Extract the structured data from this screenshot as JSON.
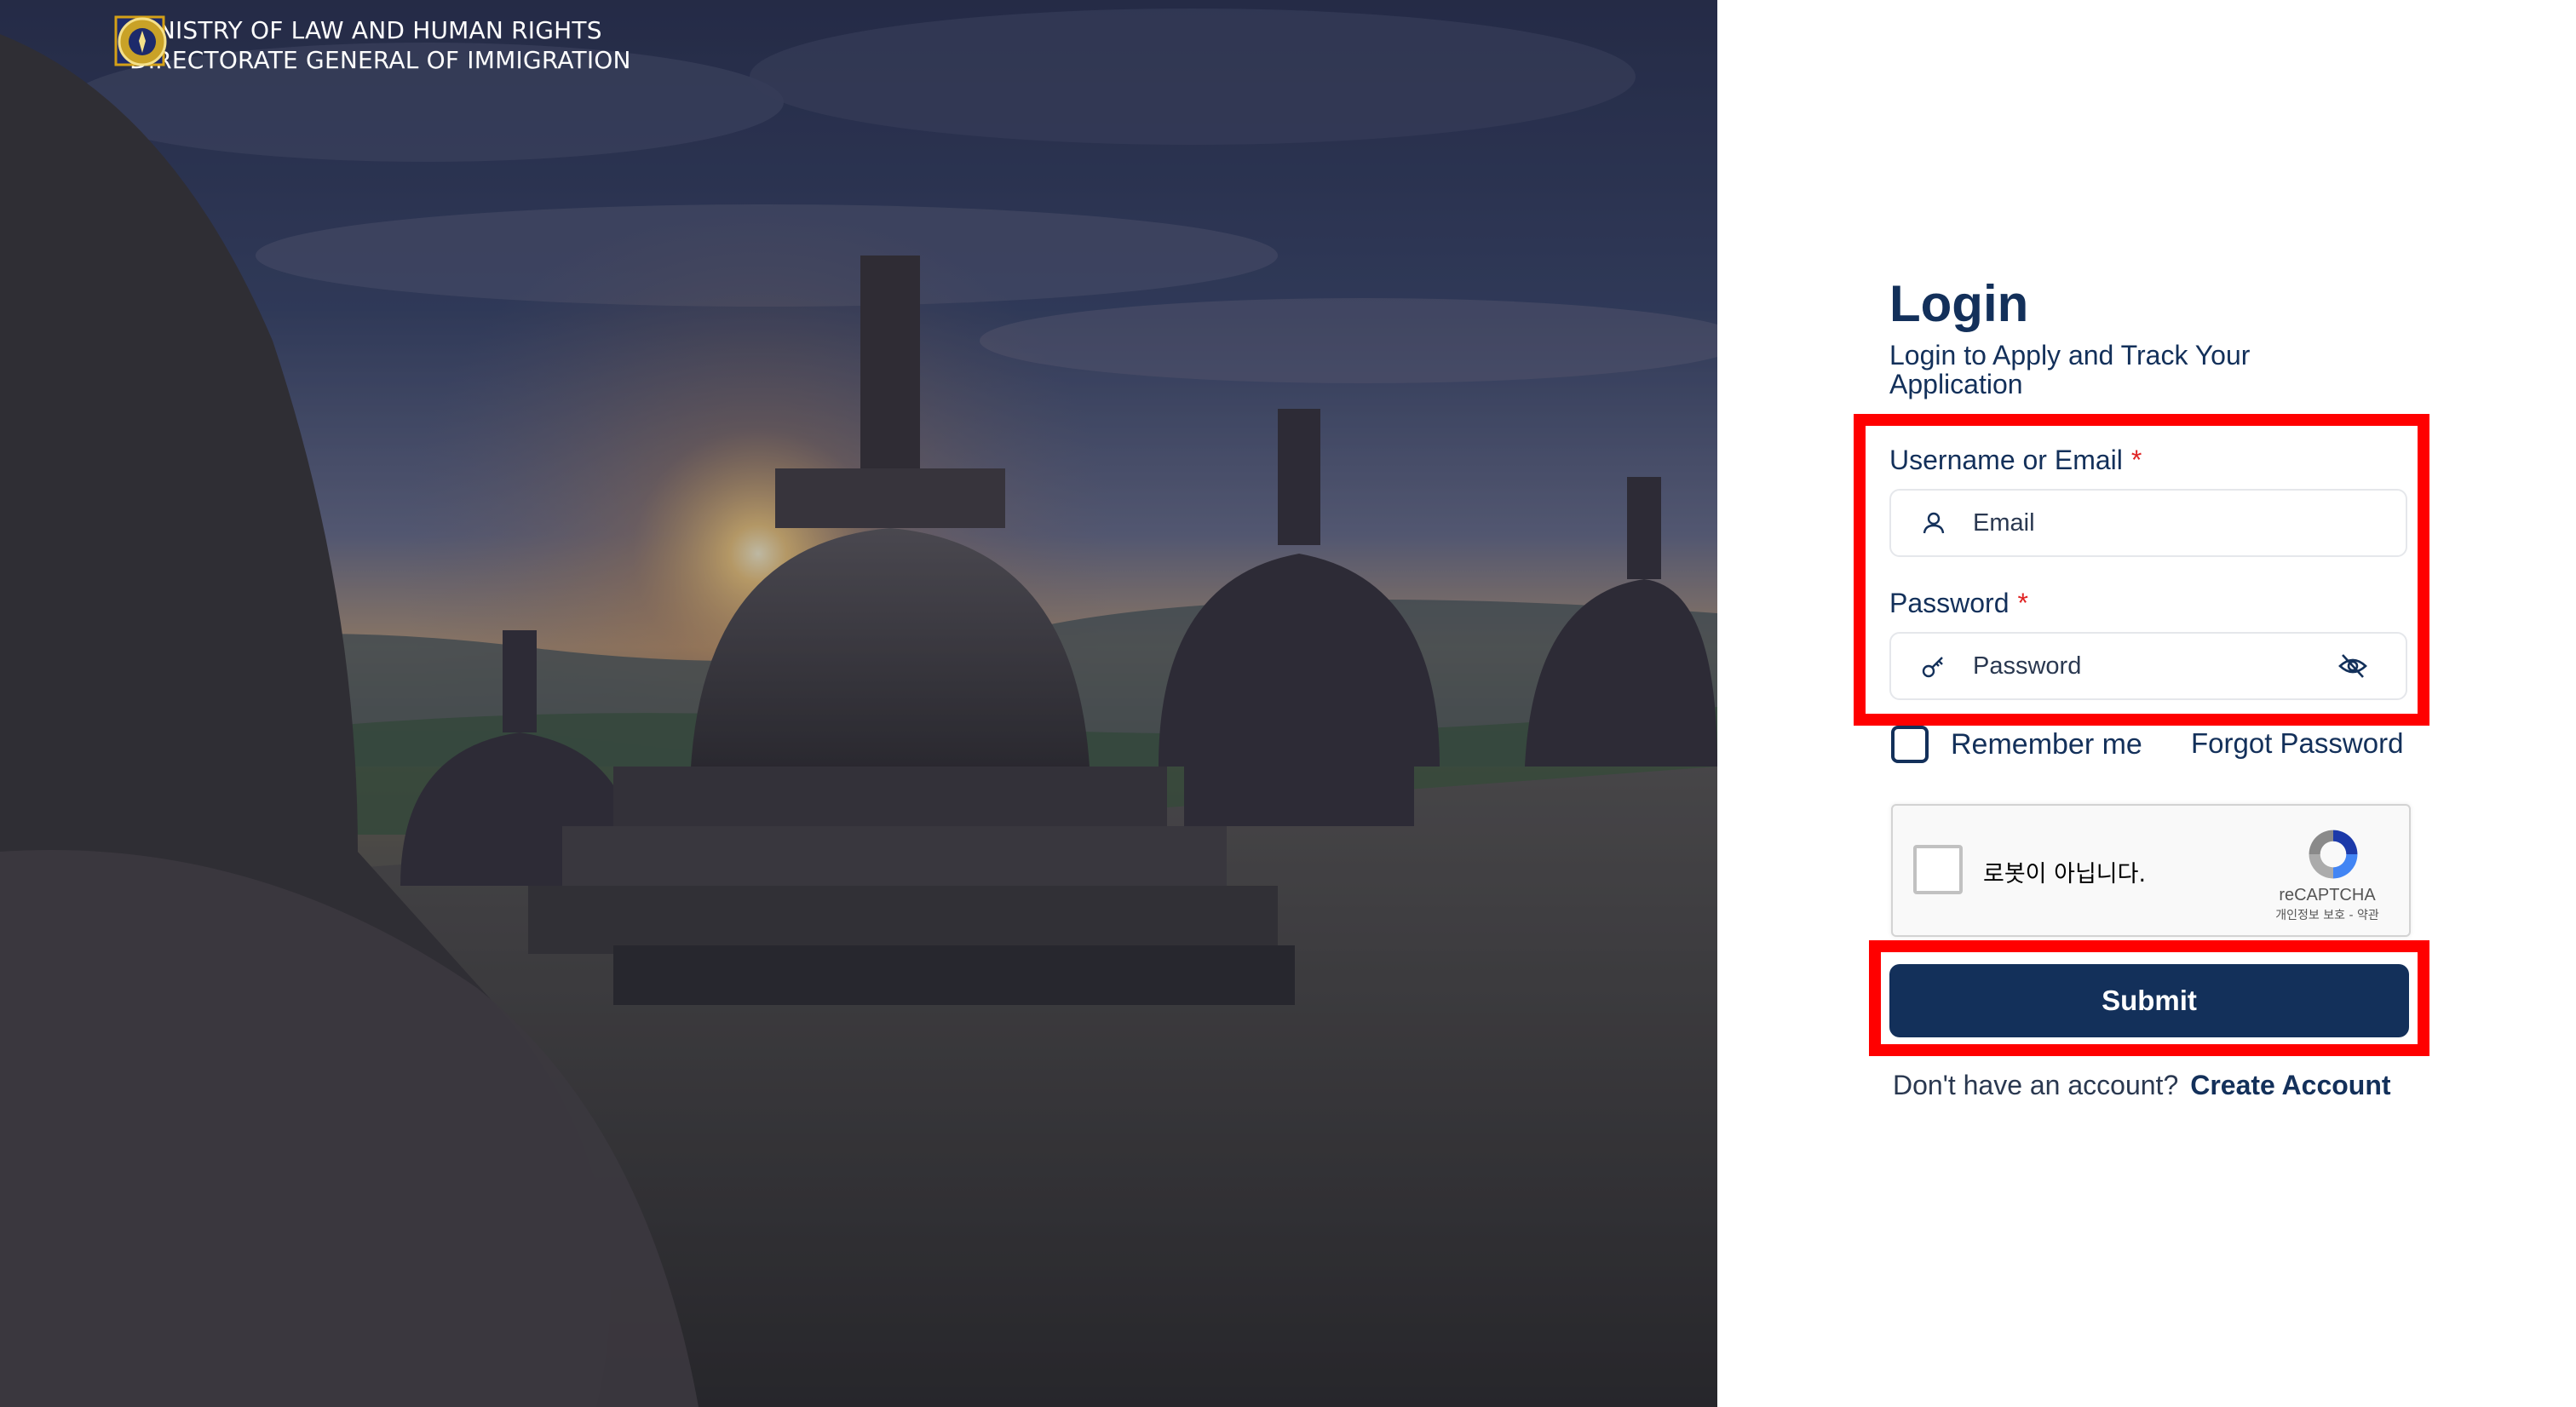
{
  "header": {
    "ministry_line1": "MINISTRY OF  LAW  AND HUMAN RIGHTS",
    "ministry_line2": "DIRECTORATE GENERAL OF IMMIGRATION",
    "logo1": "kemenkumham-logo",
    "logo2": "immigration-emblem"
  },
  "login": {
    "title": "Login",
    "subtitle": "Login to Apply and Track Your Application",
    "username_label": "Username or Email",
    "required_mark": "*",
    "username_placeholder": "Email",
    "password_label": "Password",
    "password_placeholder": "Password",
    "remember_label": "Remember me",
    "forgot_label": "Forgot Password",
    "submit_label": "Submit",
    "no_account_text": "Don't have an account?",
    "create_account_label": "Create Account"
  },
  "recaptcha": {
    "checkbox_text": "로봇이 아닙니다.",
    "brand": "reCAPTCHA",
    "terms": "개인정보 보호 - 약관"
  },
  "icons": {
    "user": "user-icon",
    "key": "key-icon",
    "eye_off": "eye-off-icon"
  },
  "colors": {
    "primary": "#13305a",
    "highlight": "#ff0000",
    "required": "#e02424"
  }
}
